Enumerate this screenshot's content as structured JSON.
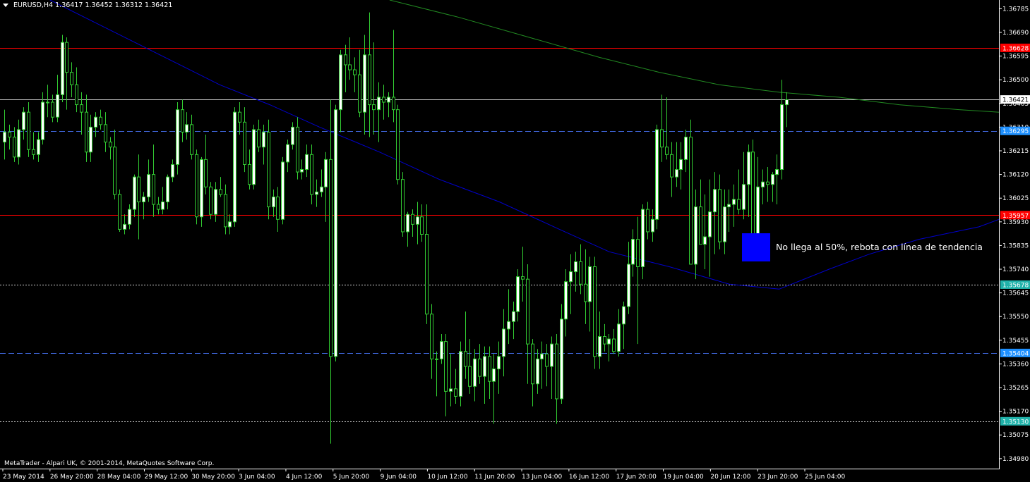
{
  "header": {
    "symbol": "EURUSD,H4",
    "ohlc": "1.36417 1.36452 1.36312 1.36421"
  },
  "footer": {
    "copyright": "MetaTrader - Alpari UK, © 2001-2014, MetaQuotes Software Corp."
  },
  "annotation": {
    "text": "No llega al 50%, rebota con línea de tendencia"
  },
  "colors": {
    "background": "#000000",
    "axis": "#ffffff",
    "bull_body": "#ffffff",
    "bear_body": "#000000",
    "wick": "#32cd32",
    "level_red": "#ff0000",
    "level_blue_dash": "#4169e1",
    "level_dotted": "#d3d3d3",
    "ma_fast": "#0000cd",
    "ma_slow": "#228b22",
    "annotation_box": "#0000ff"
  },
  "chart_data": {
    "type": "candlestick",
    "ylim": [
      1.3494,
      1.3682
    ],
    "y_ticks": [
      "1.36785",
      "1.36690",
      "1.36595",
      "1.36500",
      "1.36405",
      "1.36310",
      "1.36215",
      "1.36120",
      "1.36025",
      "1.35930",
      "1.35835",
      "1.35740",
      "1.35645",
      "1.35550",
      "1.35455",
      "1.35360",
      "1.35265",
      "1.35170",
      "1.35075",
      "1.34980"
    ],
    "x_labels": [
      "23 May 2014",
      "26 May 20:00",
      "28 May 04:00",
      "29 May 12:00",
      "30 May 20:00",
      "3 Jun 04:00",
      "4 Jun 12:00",
      "5 Jun 20:00",
      "9 Jun 04:00",
      "10 Jun 12:00",
      "11 Jun 20:00",
      "13 Jun 04:00",
      "16 Jun 12:00",
      "17 Jun 20:00",
      "19 Jun 04:00",
      "20 Jun 12:00",
      "23 Jun 20:00",
      "25 Jun 04:00"
    ],
    "levels": [
      {
        "price": 1.36628,
        "label": "1.36628",
        "style": "solid",
        "color": "#ff0000",
        "label_bg": "#ff0000",
        "label_fg": "#ffffff"
      },
      {
        "price": 1.36421,
        "label": "1.36421",
        "style": "solid",
        "color": "#c0c0c0",
        "label_bg": "#ffffff",
        "label_fg": "#000000"
      },
      {
        "price": 1.36295,
        "label": "1.36295",
        "style": "dashed",
        "color": "#4169e1",
        "label_bg": "#1e90ff",
        "label_fg": "#ffffff"
      },
      {
        "price": 1.35957,
        "label": "1.35957",
        "style": "solid",
        "color": "#ff0000",
        "label_bg": "#ff0000",
        "label_fg": "#ffffff"
      },
      {
        "price": 1.35678,
        "label": "1.35678",
        "style": "dotted",
        "color": "#d3d3d3",
        "label_bg": "#20b2aa",
        "label_fg": "#ffffff"
      },
      {
        "price": 1.35404,
        "label": "1.35404",
        "style": "dashed",
        "color": "#4169e1",
        "label_bg": "#1e90ff",
        "label_fg": "#ffffff"
      },
      {
        "price": 1.3513,
        "label": "1.35130",
        "style": "dotted",
        "color": "#d3d3d3",
        "label_bg": "#20b2aa",
        "label_fg": "#ffffff"
      }
    ],
    "candles": [
      [
        1.3625,
        1.3638,
        1.3618,
        1.3629
      ],
      [
        1.3629,
        1.3632,
        1.3622,
        1.3627
      ],
      [
        1.3627,
        1.3631,
        1.3617,
        1.3619
      ],
      [
        1.3619,
        1.3634,
        1.3616,
        1.363
      ],
      [
        1.363,
        1.3639,
        1.3626,
        1.3637
      ],
      [
        1.3637,
        1.3641,
        1.3619,
        1.3622
      ],
      [
        1.3622,
        1.3629,
        1.3618,
        1.362
      ],
      [
        1.362,
        1.3629,
        1.3617,
        1.3626
      ],
      [
        1.3626,
        1.3645,
        1.3624,
        1.3641
      ],
      [
        1.3641,
        1.3648,
        1.3635,
        1.3641
      ],
      [
        1.3641,
        1.3644,
        1.3633,
        1.3635
      ],
      [
        1.3635,
        1.3652,
        1.3633,
        1.3644
      ],
      [
        1.3644,
        1.3668,
        1.3641,
        1.3665
      ],
      [
        1.3665,
        1.3667,
        1.3638,
        1.3653
      ],
      [
        1.3653,
        1.3657,
        1.3643,
        1.3648
      ],
      [
        1.3648,
        1.3655,
        1.3637,
        1.364
      ],
      [
        1.364,
        1.3645,
        1.3628,
        1.3637
      ],
      [
        1.3637,
        1.3644,
        1.3617,
        1.3621
      ],
      [
        1.3621,
        1.3636,
        1.3617,
        1.3631
      ],
      [
        1.3631,
        1.3637,
        1.3627,
        1.3635
      ],
      [
        1.3635,
        1.3638,
        1.363,
        1.3632
      ],
      [
        1.3632,
        1.3637,
        1.3621,
        1.3625
      ],
      [
        1.3625,
        1.3627,
        1.3618,
        1.3623
      ],
      [
        1.3623,
        1.363,
        1.3602,
        1.3604
      ],
      [
        1.3604,
        1.3606,
        1.3589,
        1.359
      ],
      [
        1.359,
        1.3596,
        1.3588,
        1.3592
      ],
      [
        1.3592,
        1.36,
        1.359,
        1.3598
      ],
      [
        1.3598,
        1.3612,
        1.3595,
        1.3611
      ],
      [
        1.3611,
        1.362,
        1.3586,
        1.3601
      ],
      [
        1.3601,
        1.3605,
        1.3594,
        1.3603
      ],
      [
        1.3603,
        1.3618,
        1.3601,
        1.3612
      ],
      [
        1.3612,
        1.3624,
        1.3595,
        1.36
      ],
      [
        1.36,
        1.3603,
        1.3596,
        1.3598
      ],
      [
        1.3598,
        1.3607,
        1.3596,
        1.3601
      ],
      [
        1.3601,
        1.3612,
        1.3598,
        1.3611
      ],
      [
        1.3611,
        1.3618,
        1.3609,
        1.3616
      ],
      [
        1.3616,
        1.3641,
        1.3612,
        1.3638
      ],
      [
        1.3638,
        1.3642,
        1.3625,
        1.3629
      ],
      [
        1.3629,
        1.3637,
        1.3626,
        1.3632
      ],
      [
        1.3632,
        1.3636,
        1.3618,
        1.362
      ],
      [
        1.362,
        1.3622,
        1.3592,
        1.3595
      ],
      [
        1.3595,
        1.3619,
        1.3591,
        1.3618
      ],
      [
        1.3618,
        1.3628,
        1.3604,
        1.3607
      ],
      [
        1.3607,
        1.3609,
        1.3594,
        1.3596
      ],
      [
        1.3596,
        1.3609,
        1.3593,
        1.3606
      ],
      [
        1.3606,
        1.3611,
        1.3603,
        1.3604
      ],
      [
        1.3604,
        1.3608,
        1.3588,
        1.3591
      ],
      [
        1.3591,
        1.3596,
        1.3588,
        1.3593
      ],
      [
        1.3593,
        1.3639,
        1.3591,
        1.3637
      ],
      [
        1.3637,
        1.3641,
        1.3628,
        1.3633
      ],
      [
        1.3633,
        1.3639,
        1.3613,
        1.3616
      ],
      [
        1.3616,
        1.3622,
        1.3606,
        1.3608
      ],
      [
        1.3608,
        1.3632,
        1.3606,
        1.363
      ],
      [
        1.363,
        1.3634,
        1.3621,
        1.3623
      ],
      [
        1.3623,
        1.3632,
        1.3616,
        1.3629
      ],
      [
        1.3629,
        1.3634,
        1.3594,
        1.3599
      ],
      [
        1.3599,
        1.3606,
        1.3595,
        1.3603
      ],
      [
        1.3603,
        1.3607,
        1.3589,
        1.3594
      ],
      [
        1.3594,
        1.3619,
        1.3592,
        1.3617
      ],
      [
        1.3617,
        1.3626,
        1.3613,
        1.3624
      ],
      [
        1.3624,
        1.3633,
        1.3622,
        1.3631
      ],
      [
        1.3631,
        1.3635,
        1.361,
        1.3613
      ],
      [
        1.3613,
        1.3618,
        1.361,
        1.3614
      ],
      [
        1.3614,
        1.3624,
        1.3611,
        1.362
      ],
      [
        1.362,
        1.3624,
        1.36,
        1.3604
      ],
      [
        1.3604,
        1.361,
        1.3599,
        1.3605
      ],
      [
        1.3605,
        1.3614,
        1.3603,
        1.3607
      ],
      [
        1.3607,
        1.3621,
        1.3593,
        1.3618
      ],
      [
        1.3618,
        1.3642,
        1.3504,
        1.3539
      ],
      [
        1.3539,
        1.364,
        1.3537,
        1.3638
      ],
      [
        1.3638,
        1.3662,
        1.3629,
        1.366
      ],
      [
        1.366,
        1.3664,
        1.3645,
        1.3656
      ],
      [
        1.3656,
        1.3667,
        1.365,
        1.3654
      ],
      [
        1.3654,
        1.3659,
        1.3645,
        1.3652
      ],
      [
        1.3652,
        1.3662,
        1.3635,
        1.3637
      ],
      [
        1.3637,
        1.3668,
        1.3628,
        1.366
      ],
      [
        1.366,
        1.3677,
        1.3627,
        1.364
      ],
      [
        1.364,
        1.3665,
        1.3628,
        1.3638
      ],
      [
        1.3638,
        1.3649,
        1.3625,
        1.3643
      ],
      [
        1.3643,
        1.3648,
        1.3634,
        1.3641
      ],
      [
        1.3641,
        1.3645,
        1.3635,
        1.3643
      ],
      [
        1.3643,
        1.367,
        1.3633,
        1.3638
      ],
      [
        1.3638,
        1.364,
        1.3608,
        1.361
      ],
      [
        1.361,
        1.3613,
        1.3587,
        1.3589
      ],
      [
        1.3589,
        1.3597,
        1.3583,
        1.3596
      ],
      [
        1.3596,
        1.3598,
        1.3587,
        1.3592
      ],
      [
        1.3592,
        1.3601,
        1.3584,
        1.3595
      ],
      [
        1.3595,
        1.36,
        1.3585,
        1.3588
      ],
      [
        1.3588,
        1.36,
        1.3552,
        1.3556
      ],
      [
        1.3556,
        1.356,
        1.353,
        1.3538
      ],
      [
        1.3538,
        1.3541,
        1.3523,
        1.3538
      ],
      [
        1.3538,
        1.3548,
        1.3536,
        1.3545
      ],
      [
        1.3545,
        1.3548,
        1.3515,
        1.3525
      ],
      [
        1.3525,
        1.354,
        1.3519,
        1.3526
      ],
      [
        1.3526,
        1.3534,
        1.352,
        1.3523
      ],
      [
        1.3523,
        1.3545,
        1.3519,
        1.3541
      ],
      [
        1.3541,
        1.3557,
        1.353,
        1.3535
      ],
      [
        1.3535,
        1.3546,
        1.3524,
        1.3527
      ],
      [
        1.3527,
        1.3542,
        1.3521,
        1.3538
      ],
      [
        1.3538,
        1.3544,
        1.3528,
        1.3531
      ],
      [
        1.3531,
        1.3543,
        1.352,
        1.3539
      ],
      [
        1.3539,
        1.3543,
        1.3522,
        1.3529
      ],
      [
        1.3529,
        1.354,
        1.3512,
        1.3534
      ],
      [
        1.3534,
        1.3545,
        1.3524,
        1.3539
      ],
      [
        1.3539,
        1.3558,
        1.3531,
        1.355
      ],
      [
        1.355,
        1.3566,
        1.3544,
        1.3553
      ],
      [
        1.3553,
        1.3561,
        1.3546,
        1.3557
      ],
      [
        1.3557,
        1.3574,
        1.3553,
        1.3571
      ],
      [
        1.3571,
        1.3583,
        1.3561,
        1.357
      ],
      [
        1.357,
        1.3576,
        1.3528,
        1.3544
      ],
      [
        1.3544,
        1.3546,
        1.3519,
        1.3528
      ],
      [
        1.3528,
        1.3542,
        1.3524,
        1.3538
      ],
      [
        1.3538,
        1.3545,
        1.3526,
        1.354
      ],
      [
        1.354,
        1.3544,
        1.3527,
        1.3535
      ],
      [
        1.3535,
        1.3547,
        1.3522,
        1.3544
      ],
      [
        1.3544,
        1.3548,
        1.3512,
        1.3522
      ],
      [
        1.3522,
        1.356,
        1.352,
        1.3554
      ],
      [
        1.3554,
        1.3574,
        1.3547,
        1.3569
      ],
      [
        1.3569,
        1.358,
        1.3556,
        1.3573
      ],
      [
        1.3573,
        1.3581,
        1.3565,
        1.3577
      ],
      [
        1.3577,
        1.3584,
        1.3564,
        1.3568
      ],
      [
        1.3568,
        1.3582,
        1.3552,
        1.3561
      ],
      [
        1.3561,
        1.3579,
        1.3549,
        1.3575
      ],
      [
        1.3575,
        1.3579,
        1.3534,
        1.3539
      ],
      [
        1.3539,
        1.3557,
        1.3534,
        1.3547
      ],
      [
        1.3547,
        1.3552,
        1.3541,
        1.3544
      ],
      [
        1.3544,
        1.3548,
        1.3537,
        1.3546
      ],
      [
        1.3546,
        1.355,
        1.354,
        1.3541
      ],
      [
        1.3541,
        1.3558,
        1.3539,
        1.3552
      ],
      [
        1.3552,
        1.3561,
        1.3542,
        1.3559
      ],
      [
        1.3559,
        1.3585,
        1.3556,
        1.3576
      ],
      [
        1.3576,
        1.359,
        1.3571,
        1.3586
      ],
      [
        1.3586,
        1.3595,
        1.3544,
        1.3575
      ],
      [
        1.3575,
        1.36,
        1.357,
        1.3598
      ],
      [
        1.3598,
        1.3601,
        1.3586,
        1.3589
      ],
      [
        1.3589,
        1.3598,
        1.3585,
        1.3594
      ],
      [
        1.3594,
        1.3632,
        1.359,
        1.363
      ],
      [
        1.363,
        1.3644,
        1.3617,
        1.3623
      ],
      [
        1.3623,
        1.3643,
        1.3618,
        1.362
      ],
      [
        1.362,
        1.3625,
        1.3603,
        1.3611
      ],
      [
        1.3611,
        1.3625,
        1.3607,
        1.3614
      ],
      [
        1.3614,
        1.3625,
        1.3606,
        1.3618
      ],
      [
        1.3618,
        1.363,
        1.3613,
        1.3627
      ],
      [
        1.3627,
        1.3634,
        1.3603,
        1.3576
      ],
      [
        1.3576,
        1.3606,
        1.357,
        1.3599
      ],
      [
        1.3599,
        1.361,
        1.3591,
        1.3584
      ],
      [
        1.3584,
        1.3604,
        1.3574,
        1.3587
      ],
      [
        1.3587,
        1.361,
        1.3571,
        1.3597
      ],
      [
        1.3597,
        1.3613,
        1.358,
        1.3606
      ],
      [
        1.3606,
        1.3612,
        1.3582,
        1.3585
      ],
      [
        1.3585,
        1.3606,
        1.358,
        1.3599
      ],
      [
        1.3599,
        1.3606,
        1.3589,
        1.36
      ],
      [
        1.36,
        1.3608,
        1.3591,
        1.3602
      ],
      [
        1.3602,
        1.3614,
        1.3596,
        1.3598
      ],
      [
        1.3598,
        1.3621,
        1.3594,
        1.3608
      ],
      [
        1.3608,
        1.3624,
        1.3595,
        1.3621
      ],
      [
        1.3621,
        1.3626,
        1.3598,
        1.3587
      ],
      [
        1.3587,
        1.3619,
        1.3585,
        1.3607
      ],
      [
        1.3607,
        1.3614,
        1.36,
        1.3609
      ],
      [
        1.3609,
        1.3615,
        1.3601,
        1.3608
      ],
      [
        1.3608,
        1.3613,
        1.3601,
        1.3612
      ],
      [
        1.3612,
        1.362,
        1.36,
        1.3614
      ],
      [
        1.3614,
        1.365,
        1.361,
        1.364
      ],
      [
        1.364,
        1.3645,
        1.3631,
        1.3642
      ]
    ],
    "ma_fast": [
      [
        0.05,
        1.3682
      ],
      [
        0.1,
        1.3672
      ],
      [
        0.16,
        1.366
      ],
      [
        0.22,
        1.3648
      ],
      [
        0.27,
        1.364
      ],
      [
        0.32,
        1.3631
      ],
      [
        0.38,
        1.3621
      ],
      [
        0.44,
        1.361
      ],
      [
        0.5,
        1.3601
      ],
      [
        0.56,
        1.359
      ],
      [
        0.61,
        1.3581
      ],
      [
        0.67,
        1.3575
      ],
      [
        0.73,
        1.3568
      ],
      [
        0.78,
        1.3566
      ],
      [
        0.83,
        1.3574
      ],
      [
        0.87,
        1.358
      ],
      [
        0.92,
        1.3586
      ],
      [
        0.98,
        1.3591
      ],
      [
        1.0,
        1.3594
      ]
    ],
    "ma_slow": [
      [
        0.39,
        1.3682
      ],
      [
        0.46,
        1.3675
      ],
      [
        0.53,
        1.3667
      ],
      [
        0.6,
        1.3659
      ],
      [
        0.66,
        1.3653
      ],
      [
        0.72,
        1.3648
      ],
      [
        0.78,
        1.3645
      ],
      [
        0.84,
        1.3643
      ],
      [
        0.9,
        1.364
      ],
      [
        0.96,
        1.3638
      ],
      [
        1.0,
        1.3637
      ]
    ]
  }
}
